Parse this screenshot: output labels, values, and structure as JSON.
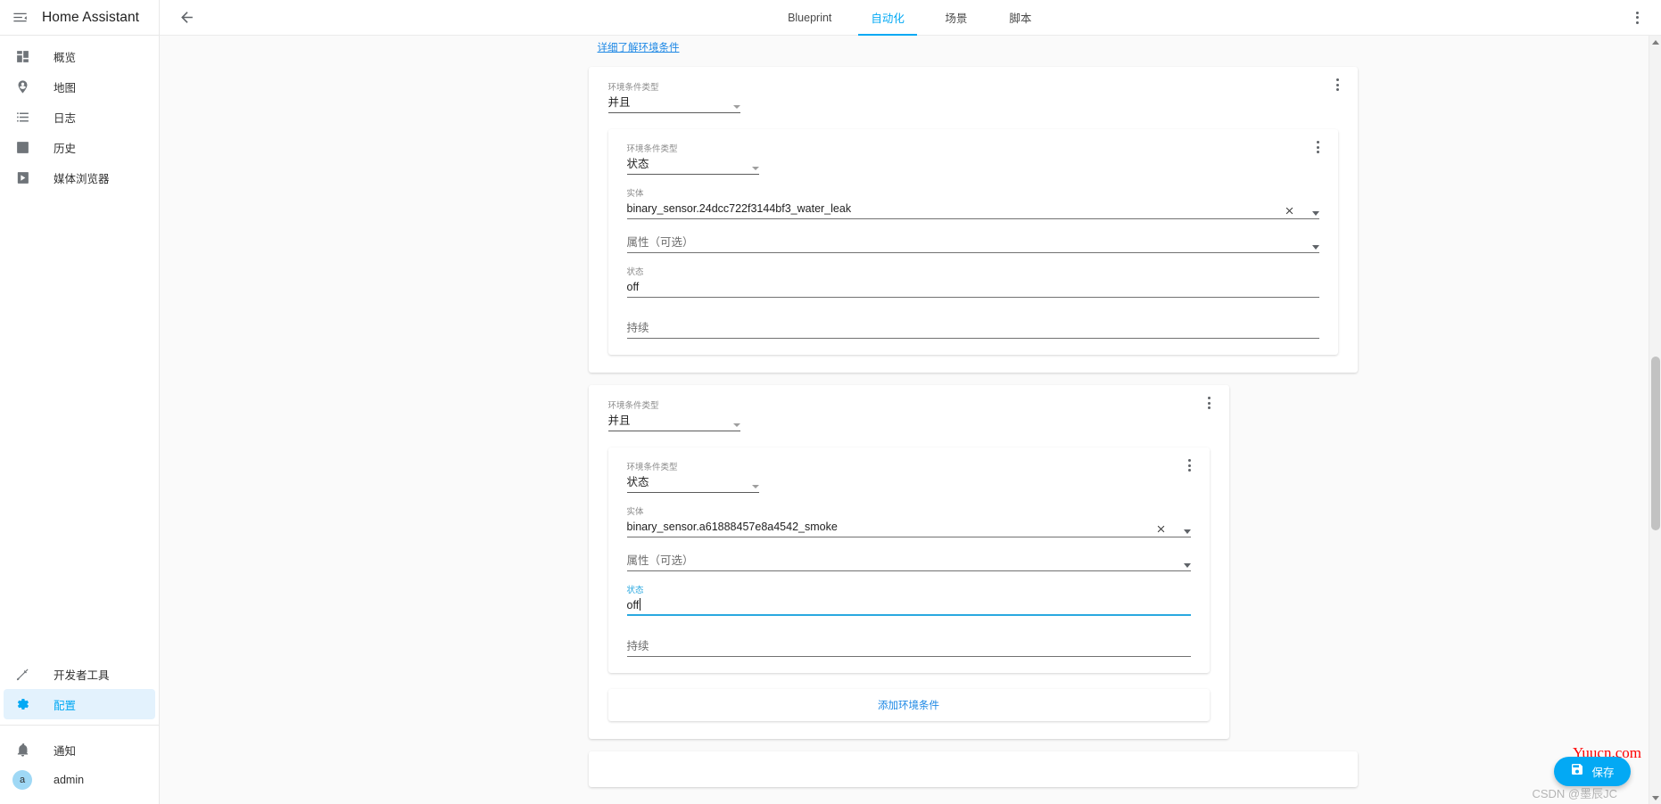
{
  "sidebar": {
    "menu_icon": "hamburger-menu-icon",
    "title": "Home Assistant",
    "items": [
      {
        "label": "概览",
        "icon": "dashboard-icon"
      },
      {
        "label": "地图",
        "icon": "map-marker-account-icon"
      },
      {
        "label": "日志",
        "icon": "format-list-bulleted-icon"
      },
      {
        "label": "历史",
        "icon": "chart-box-icon"
      },
      {
        "label": "媒体浏览器",
        "icon": "play-box-icon"
      }
    ],
    "bottom_items": [
      {
        "label": "开发者工具",
        "icon": "hammer-icon",
        "active": false
      },
      {
        "label": "配置",
        "icon": "cog-icon",
        "active": true
      }
    ],
    "footer_items": [
      {
        "label": "通知",
        "icon": "bell-icon"
      },
      {
        "label": "admin",
        "icon": "avatar",
        "avatar_initial": "a"
      }
    ]
  },
  "topbar": {
    "back_icon": "arrow-left-icon",
    "overflow_icon": "dots-vertical-icon",
    "tabs": [
      {
        "label": "Blueprint",
        "active": false
      },
      {
        "label": "自动化",
        "active": true
      },
      {
        "label": "场景",
        "active": false
      },
      {
        "label": "脚本",
        "active": false
      }
    ]
  },
  "content": {
    "learn_more_link": "详细了解环境条件",
    "add_condition_label": "添加环境条件",
    "labels": {
      "condition_type": "环境条件类型",
      "entity": "实体",
      "attribute": "属性（可选）",
      "state": "状态",
      "duration": "持续"
    },
    "card1": {
      "condition_type_value": "并且",
      "sub": {
        "condition_type_value": "状态",
        "entity_value": "binary_sensor.24dcc722f3144bf3_water_leak",
        "attribute_value": "",
        "state_value": "off",
        "duration_value": ""
      }
    },
    "card2": {
      "condition_type_value": "并且",
      "sub": {
        "condition_type_value": "状态",
        "entity_value": "binary_sensor.a61888457e8a4542_smoke",
        "attribute_value": "",
        "state_value": "off",
        "state_focused": true,
        "duration_value": ""
      }
    }
  },
  "fab": {
    "label": "保存",
    "icon": "content-save-icon"
  },
  "watermarks": {
    "red": "Yuucn.com",
    "grey": "CSDN @墨辰JC"
  },
  "colors": {
    "accent": "#03a9f4",
    "link": "#1e88e5",
    "sidebar_active_bg": "#e3f2fd",
    "watermark_red": "#ff0000"
  }
}
